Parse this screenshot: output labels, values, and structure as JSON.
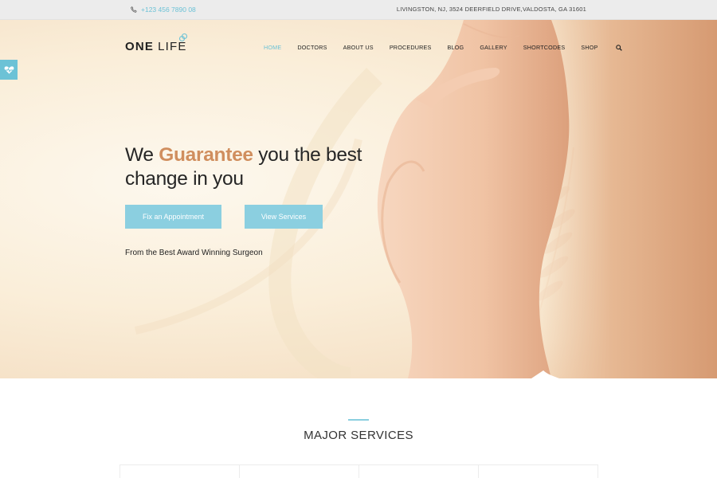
{
  "topbar": {
    "phone": "+123 456 7890 08",
    "address": "LIVINGSTON, NJ, 3524 DEERFIELD DRIVE,VALDOSTA, GA 31601"
  },
  "logo": {
    "part1": "ONE",
    "part2": "LIFE"
  },
  "nav": {
    "items": [
      {
        "label": "HOME",
        "active": true
      },
      {
        "label": "DOCTORS",
        "active": false
      },
      {
        "label": "ABOUT US",
        "active": false
      },
      {
        "label": "PROCEDURES",
        "active": false
      },
      {
        "label": "BLOG",
        "active": false
      },
      {
        "label": "GALLERY",
        "active": false
      },
      {
        "label": "SHORTCODES",
        "active": false
      },
      {
        "label": "SHOP",
        "active": false
      }
    ],
    "search_icon": "search-icon"
  },
  "hero": {
    "headline_pre": "We",
    "headline_em": "Guarantee",
    "headline_post": "you the best",
    "headline_line2": "change in you",
    "btn_appointment": "Fix an Appointment",
    "btn_services": "View Services",
    "tagline": "From the Best Award Winning Surgeon"
  },
  "side_tab": {
    "icon": "heart-pulse-icon"
  },
  "services": {
    "title": "MAJOR SERVICES",
    "cards": 4
  },
  "colors": {
    "accent": "#6cc2d6",
    "button": "#8bcfe0",
    "highlight": "#d08e5e"
  }
}
